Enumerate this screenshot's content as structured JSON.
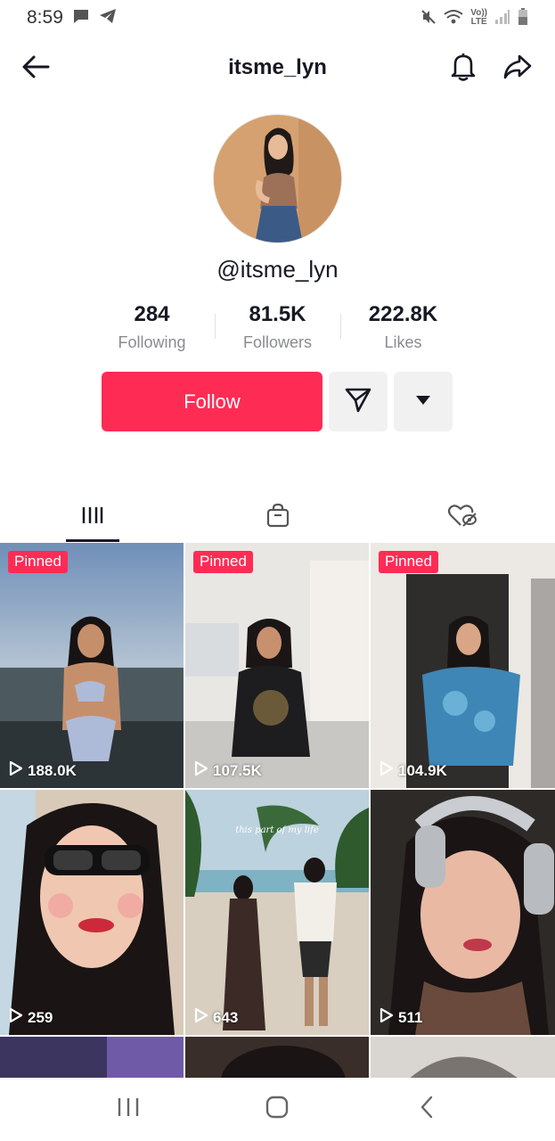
{
  "status_bar": {
    "time": "8:59",
    "network_label_top": "Vo))",
    "network_label_bottom": "LTE",
    "icons": [
      "chat-icon",
      "telegram-icon",
      "mute-icon",
      "wifi-icon",
      "signal-icon",
      "battery-icon"
    ]
  },
  "header": {
    "title": "itsme_lyn",
    "icons": [
      "back-arrow-icon",
      "bell-icon",
      "share-icon"
    ]
  },
  "profile": {
    "handle": "@itsme_lyn",
    "stats": [
      {
        "value": "284",
        "label": "Following"
      },
      {
        "value": "81.5K",
        "label": "Followers"
      },
      {
        "value": "222.8K",
        "label": "Likes"
      }
    ],
    "follow_label": "Follow",
    "accent_color": "#fe2c55"
  },
  "tabs": [
    {
      "name": "videos",
      "icon": "grid-icon",
      "active": true
    },
    {
      "name": "shop",
      "icon": "shopping-bag-icon",
      "active": false
    },
    {
      "name": "liked",
      "icon": "hidden-heart-icon",
      "active": false
    }
  ],
  "videos": [
    {
      "pinned": true,
      "badge": "Pinned",
      "views": "188.0K"
    },
    {
      "pinned": true,
      "badge": "Pinned",
      "views": "107.5K"
    },
    {
      "pinned": true,
      "badge": "Pinned",
      "views": "104.9K"
    },
    {
      "pinned": false,
      "views": "259"
    },
    {
      "pinned": false,
      "views": "643",
      "caption": "this part of my life"
    },
    {
      "pinned": false,
      "views": "511"
    }
  ],
  "nav_bar": {
    "icons": [
      "recent-apps-icon",
      "home-icon",
      "back-icon"
    ]
  }
}
